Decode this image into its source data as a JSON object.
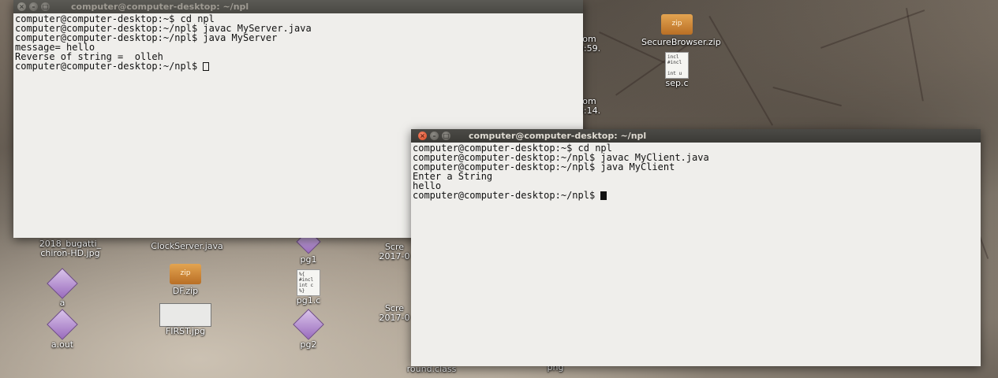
{
  "desktop": {
    "icons": [
      {
        "name": "securebrowser-zip-icon",
        "label": "SecureBrowser.zip",
        "type": "zip",
        "glyph_text": "zip"
      },
      {
        "name": "sep-c-icon",
        "label": "sep.c",
        "type": "source",
        "glyph_text": "incl\n#incl\n\nint u"
      },
      {
        "name": "bugatti-jpg-icon",
        "label": "2018_bugatti_\nchiron-HD.jpg",
        "type": "label"
      },
      {
        "name": "clockserver-java-icon",
        "label": "ClockServer.java",
        "type": "label"
      },
      {
        "name": "pg1-icon",
        "label": "pg1",
        "type": "diamond"
      },
      {
        "name": "screenshot-icon-1",
        "label": "Scre\n2017-0",
        "type": "label"
      },
      {
        "name": "a-icon",
        "label": "a",
        "type": "diamond"
      },
      {
        "name": "df-zip-icon",
        "label": "DF.zip",
        "type": "zip",
        "glyph_text": "zip"
      },
      {
        "name": "pg1-c-icon",
        "label": "pg1.c",
        "type": "source",
        "glyph_text": "%{\n#incl\nint c\n%}"
      },
      {
        "name": "a-out-icon",
        "label": "a.out",
        "type": "diamond"
      },
      {
        "name": "first-jpg-icon",
        "label": "FIRST.jpg",
        "type": "image"
      },
      {
        "name": "pg2-icon",
        "label": "pg2",
        "type": "diamond"
      },
      {
        "name": "screenshot-icon-2",
        "label": "Scre\n2017-0",
        "type": "label"
      },
      {
        "name": "round-class-icon",
        "label": "round.class",
        "type": "label"
      },
      {
        "name": "png-icon",
        "label": "png",
        "type": "label"
      },
      {
        "name": "partial-icon-1",
        "label": "om\n9:59.",
        "type": "label"
      },
      {
        "name": "partial-icon-2",
        "label": "om\n0:14.",
        "type": "label"
      }
    ]
  },
  "server_terminal": {
    "title": "computer@computer-desktop: ~/npl",
    "buttons": {
      "close": "×",
      "minimize": "–",
      "maximize": "□"
    },
    "lines": [
      "computer@computer-desktop:~$ cd npl",
      "computer@computer-desktop:~/npl$ javac MyServer.java",
      "computer@computer-desktop:~/npl$ java MyServer",
      "message= hello",
      "Reverse of string =  olleh",
      "computer@computer-desktop:~/npl$ "
    ]
  },
  "client_terminal": {
    "title": "computer@computer-desktop: ~/npl",
    "buttons": {
      "close": "×",
      "minimize": "–",
      "maximize": "□"
    },
    "lines": [
      "computer@computer-desktop:~$ cd npl",
      "computer@computer-desktop:~/npl$ javac MyClient.java",
      "computer@computer-desktop:~/npl$ java MyClient",
      "Enter a String",
      "hello",
      "computer@computer-desktop:~/npl$ "
    ]
  }
}
